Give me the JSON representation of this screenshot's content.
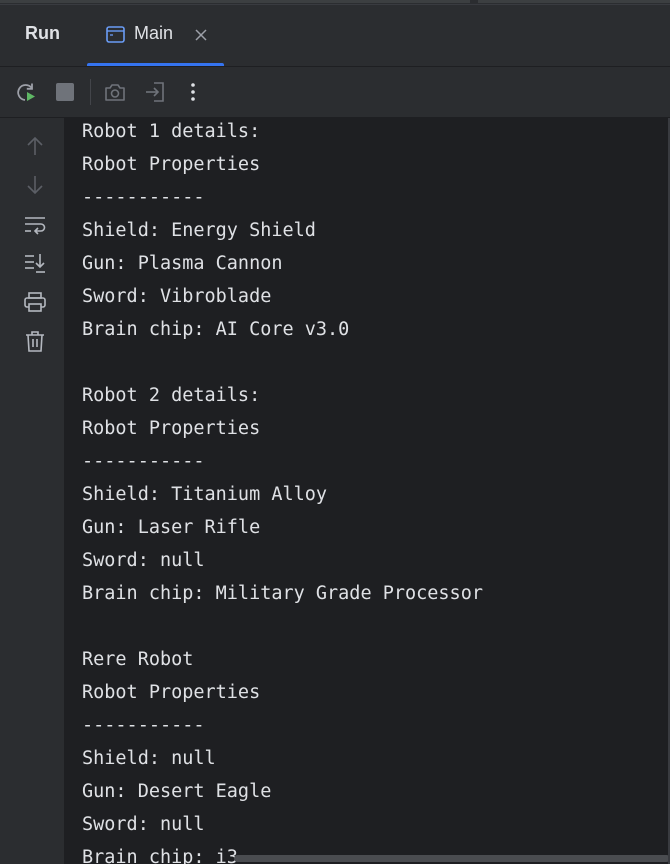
{
  "toolWindow": {
    "title": "Run"
  },
  "tabs": [
    {
      "label": "Main"
    }
  ],
  "toolbar": {
    "buttons": [
      {
        "icon": "rerun-icon"
      },
      {
        "icon": "stop-icon"
      },
      {
        "icon": "camera-icon"
      },
      {
        "icon": "exit-icon"
      },
      {
        "icon": "more-vertical-icon"
      }
    ]
  },
  "gutter": {
    "buttons": [
      {
        "icon": "arrow-up-icon"
      },
      {
        "icon": "arrow-down-icon"
      },
      {
        "icon": "soft-wrap-icon"
      },
      {
        "icon": "scroll-to-end-icon"
      },
      {
        "icon": "print-icon"
      },
      {
        "icon": "trash-icon"
      }
    ]
  },
  "console": {
    "lines": [
      "Robot 1 details:",
      "Robot Properties",
      "-----------",
      "Shield: Energy Shield",
      "Gun: Plasma Cannon",
      "Sword: Vibroblade",
      "Brain chip: AI Core v3.0",
      "",
      "Robot 2 details:",
      "Robot Properties",
      "-----------",
      "Shield: Titanium Alloy",
      "Gun: Laser Rifle",
      "Sword: null",
      "Brain chip: Military Grade Processor",
      "",
      "Rere Robot",
      "Robot Properties",
      "-----------",
      "Shield: null",
      "Gun: Desert Eagle",
      "Sword: null",
      "Brain chip: i3"
    ]
  },
  "colors": {
    "background": "#1e1f22",
    "panel": "#2b2d30",
    "accent": "#3574f0",
    "text": "#dfe1e5",
    "icon": "#9da0a8",
    "runGreen": "#5fb865"
  }
}
